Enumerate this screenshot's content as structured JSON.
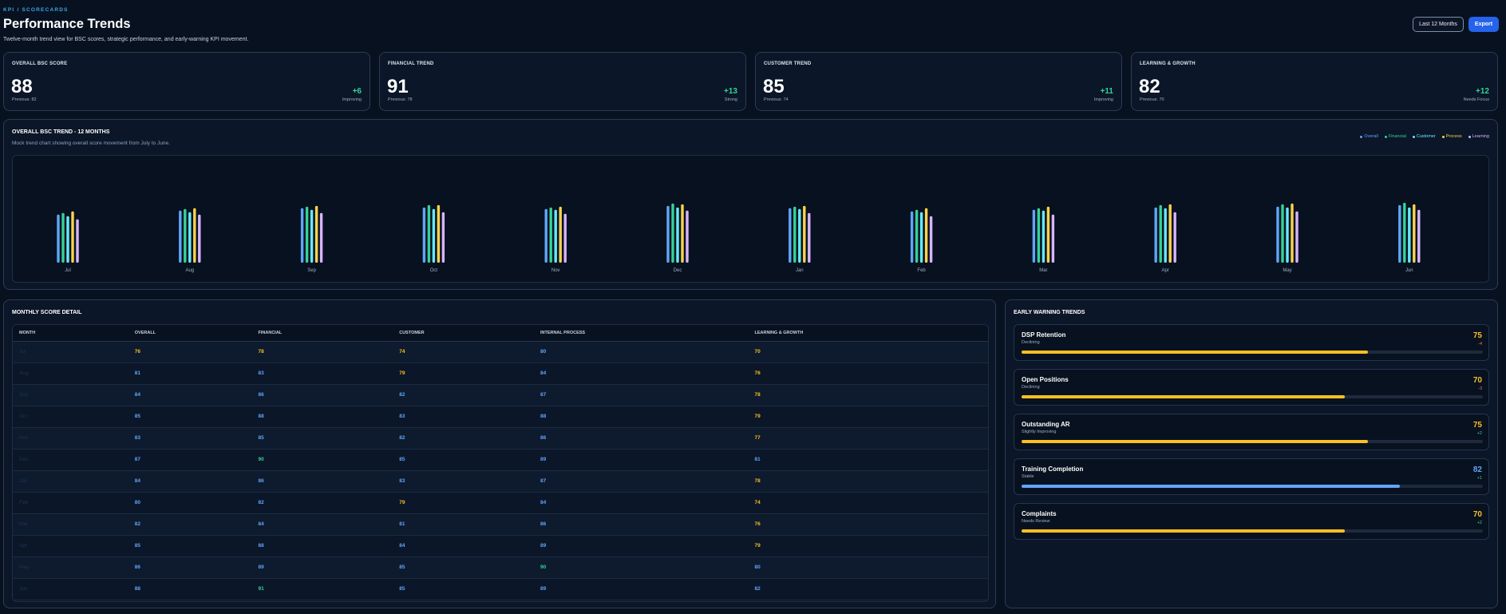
{
  "header": {
    "eyebrow": "KPI / SCORECARDS",
    "title": "Performance Trends",
    "subtitle": "Twelve-month trend view for BSC scores, strategic performance, and early-warning KPI movement.",
    "range_button": "Last 12 Months",
    "export_button": "Export"
  },
  "cards": [
    {
      "label": "OVERALL BSC SCORE",
      "value": "88",
      "previous": "Previous: 82",
      "delta": "+6",
      "status": "Improving"
    },
    {
      "label": "FINANCIAL TREND",
      "value": "91",
      "previous": "Previous: 78",
      "delta": "+13",
      "status": "Strong"
    },
    {
      "label": "CUSTOMER TREND",
      "value": "85",
      "previous": "Previous: 74",
      "delta": "+11",
      "status": "Improving"
    },
    {
      "label": "LEARNING & GROWTH",
      "value": "82",
      "previous": "Previous: 70",
      "delta": "+12",
      "status": "Needs Focus"
    }
  ],
  "trend": {
    "title": "OVERALL BSC TREND - 12 MONTHS",
    "subtitle": "Mock trend chart showing overall score movement from July to June."
  },
  "chart_data": {
    "type": "bar",
    "categories": [
      "Jul",
      "Aug",
      "Sep",
      "Oct",
      "Nov",
      "Dec",
      "Jan",
      "Feb",
      "Mar",
      "Apr",
      "May",
      "Jun"
    ],
    "series": [
      {
        "name": "Overall",
        "color": "#60a5fa",
        "values": [
          76,
          81,
          84,
          85,
          83,
          87,
          84,
          80,
          82,
          85,
          86,
          88
        ]
      },
      {
        "name": "Financial",
        "color": "#34d399",
        "values": [
          78,
          83,
          86,
          88,
          85,
          90,
          86,
          82,
          84,
          88,
          89,
          91
        ]
      },
      {
        "name": "Customer",
        "color": "#67e8f9",
        "values": [
          74,
          79,
          82,
          83,
          82,
          85,
          83,
          79,
          81,
          84,
          85,
          85
        ]
      },
      {
        "name": "Process",
        "color": "#fcd34d",
        "values": [
          80,
          84,
          87,
          88,
          86,
          89,
          87,
          84,
          86,
          89,
          90,
          89
        ]
      },
      {
        "name": "Learning",
        "color": "#d8b4fe",
        "values": [
          70,
          76,
          78,
          79,
          77,
          81,
          78,
          74,
          76,
          79,
          80,
          82
        ]
      }
    ],
    "legend_position": "top-right",
    "grid": false,
    "ylim": [
      0,
      100
    ]
  },
  "detail": {
    "title": "MONTHLY SCORE DETAIL",
    "columns": [
      "MONTH",
      "OVERALL",
      "FINANCIAL",
      "CUSTOMER",
      "INTERNAL PROCESS",
      "LEARNING & GROWTH"
    ],
    "rows": [
      [
        "Jul",
        "76",
        "78",
        "74",
        "80",
        "70"
      ],
      [
        "Aug",
        "81",
        "83",
        "79",
        "84",
        "76"
      ],
      [
        "Sep",
        "84",
        "86",
        "82",
        "87",
        "78"
      ],
      [
        "Oct",
        "85",
        "88",
        "83",
        "88",
        "79"
      ],
      [
        "Nov",
        "83",
        "85",
        "82",
        "86",
        "77"
      ],
      [
        "Dec",
        "87",
        "90",
        "85",
        "89",
        "81"
      ],
      [
        "Jan",
        "84",
        "86",
        "83",
        "87",
        "78"
      ],
      [
        "Feb",
        "80",
        "82",
        "79",
        "84",
        "74"
      ],
      [
        "Mar",
        "82",
        "84",
        "81",
        "86",
        "76"
      ],
      [
        "Apr",
        "85",
        "88",
        "84",
        "89",
        "79"
      ],
      [
        "May",
        "86",
        "89",
        "85",
        "90",
        "80"
      ],
      [
        "Jun",
        "88",
        "91",
        "85",
        "89",
        "82"
      ]
    ]
  },
  "warnings": {
    "title": "EARLY WARNING TRENDS",
    "items": [
      {
        "name": "DSP Retention",
        "status": "Declining",
        "score": "75",
        "change": "-4",
        "level": 0.75
      },
      {
        "name": "Open Positions",
        "status": "Declining",
        "score": "70",
        "change": "-3",
        "level": 0.7
      },
      {
        "name": "Outstanding AR",
        "status": "Slightly Improving",
        "score": "75",
        "change": "+2",
        "level": 0.75
      },
      {
        "name": "Training Completion",
        "status": "Stable",
        "score": "82",
        "change": "+1",
        "level": 0.82
      },
      {
        "name": "Complaints",
        "status": "Needs Review",
        "score": "70",
        "change": "+2",
        "level": 0.7
      }
    ]
  },
  "colors": {
    "accent": "#2563eb",
    "positive": "#34d399",
    "warning": "#fbbf24",
    "info": "#60a5fa",
    "negative": "#f87171"
  }
}
